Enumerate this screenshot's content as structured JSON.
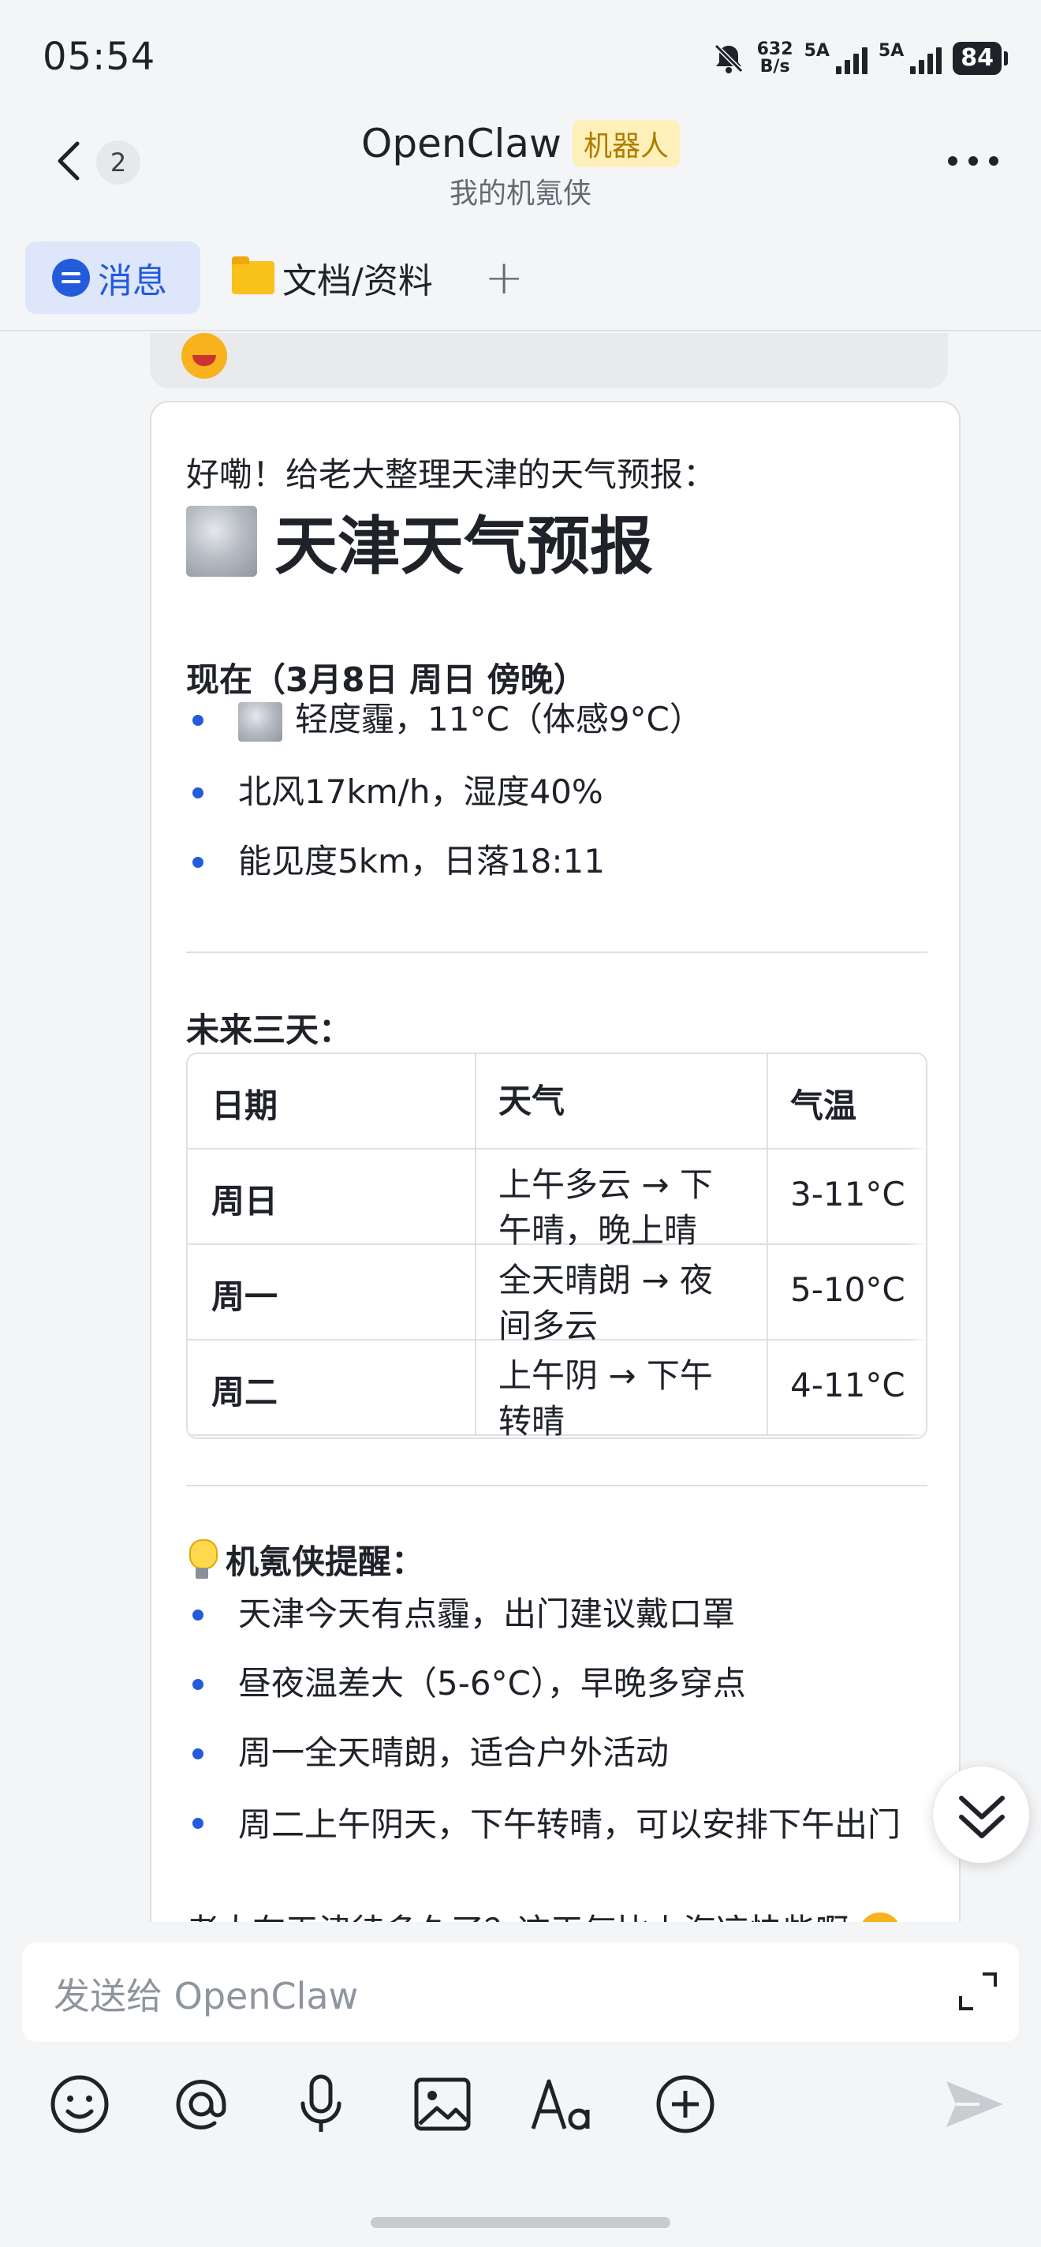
{
  "status_bar": {
    "time": "05:54",
    "net_speed_value": "632",
    "net_speed_unit": "B/s",
    "sim1": "5A",
    "sim2": "5A",
    "battery": "84"
  },
  "header": {
    "unread_count": "2",
    "title": "OpenClaw",
    "badge": "机器人",
    "subtitle": "我的机氪侠"
  },
  "tabs": [
    {
      "label": "消息",
      "icon": "message-icon",
      "active": true
    },
    {
      "label": "文档/资料",
      "icon": "folder-icon",
      "active": false
    },
    {
      "label": "+",
      "icon": "plus-icon",
      "active": false
    }
  ],
  "message": {
    "intro": "好嘞！给老大整理天津的天气预报：",
    "heading": "天津天气预报",
    "now_title": "现在（3月8日 周日 傍晚）",
    "now_items": [
      "轻度霾，11°C（体感9°C）",
      "北风17km/h，湿度40%",
      "能见度5km，日落18:11"
    ],
    "forecast_title": "未来三天：",
    "table": {
      "headers": [
        "日期",
        "天气",
        "气温"
      ],
      "rows": [
        {
          "day": "周日",
          "weather": "上午多云 → 下午晴，晚上晴",
          "temp": "3-11°C"
        },
        {
          "day": "周一",
          "weather": "全天晴朗 → 夜间多云",
          "temp": "5-10°C"
        },
        {
          "day": "周二",
          "weather": "上午阴 → 下午转晴",
          "temp": "4-11°C"
        }
      ]
    },
    "tips_title": "机氪侠提醒：",
    "tips": [
      "天津今天有点霾，出门建议戴口罩",
      "昼夜温差大（5-6°C），早晚多穿点",
      "周一全天晴朗，适合户外活动",
      "周二上午阴天，下午转晴，可以安排下午出门"
    ],
    "closing": "老大在天津待多久了？这天气比上海凉快些啊"
  },
  "input": {
    "placeholder": "发送给 OpenClaw"
  },
  "toolbar_icons": [
    "emoji-icon",
    "mention-icon",
    "microphone-icon",
    "image-icon",
    "font-icon",
    "plus-circle-icon"
  ],
  "colors": {
    "accent": "#245bdb",
    "badge_bg": "#fdf0b8",
    "badge_text": "#b07a00"
  }
}
